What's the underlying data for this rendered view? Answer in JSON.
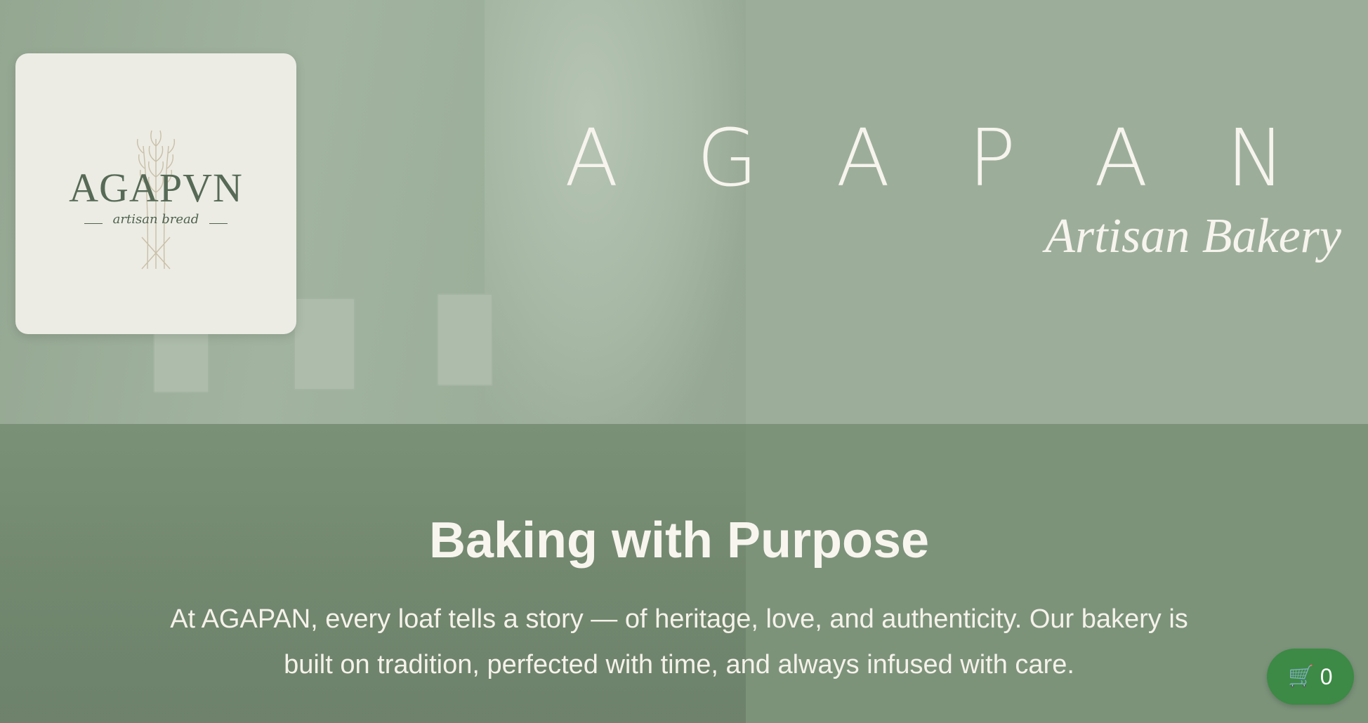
{
  "logo": {
    "wordmark": "AGAPVN",
    "tagline": "artisan bread",
    "icon": "wheat-icon"
  },
  "hero": {
    "brand_name": "A G A P A N",
    "brand_subtitle": "Artisan Bakery"
  },
  "intro": {
    "heading": "Baking with Purpose",
    "body": "At AGAPAN, every loaf tells a story — of heritage, love, and authenticity. Our bakery is built on tradition, perfected with time, and always infused with care."
  },
  "cart": {
    "icon": "cart-icon",
    "glyph": "🛒",
    "count": "0",
    "color": "#3c8a45"
  },
  "colors": {
    "sage": "#9cae9a",
    "band": "#7c937a",
    "logo_card": "#ecece4",
    "text_light": "#f7f4ee"
  }
}
